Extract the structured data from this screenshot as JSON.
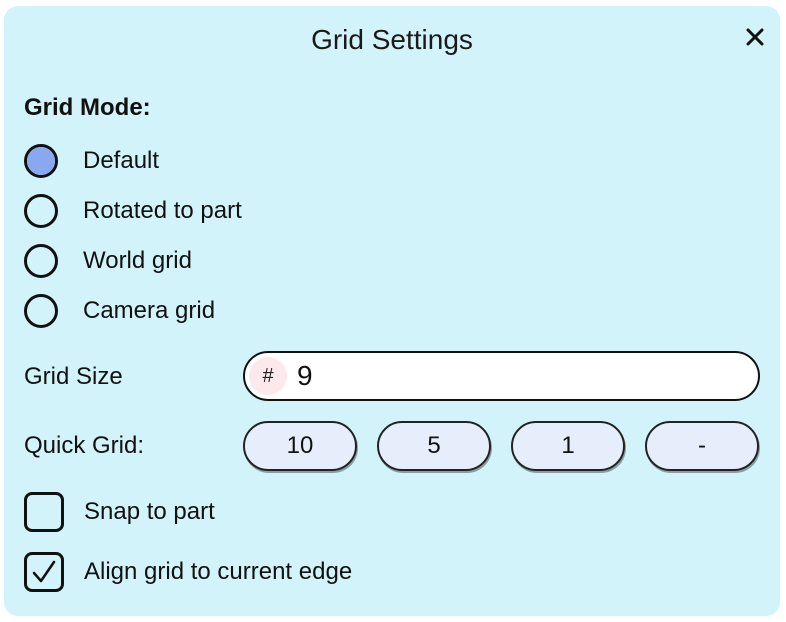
{
  "dialog": {
    "title": "Grid Settings",
    "close_icon": "close-icon"
  },
  "grid_mode": {
    "label": "Grid Mode:",
    "options": [
      {
        "label": "Default",
        "selected": true
      },
      {
        "label": "Rotated to part",
        "selected": false
      },
      {
        "label": "World grid",
        "selected": false
      },
      {
        "label": "Camera grid",
        "selected": false
      }
    ]
  },
  "grid_size": {
    "label": "Grid Size",
    "prefix": "#",
    "value": "9"
  },
  "quick_grid": {
    "label": "Quick Grid:",
    "buttons": [
      "10",
      "5",
      "1",
      "-"
    ]
  },
  "options": {
    "snap_to_part": {
      "label": "Snap to part",
      "checked": false
    },
    "align_grid": {
      "label": "Align grid to current edge",
      "checked": true
    }
  },
  "colors": {
    "background": "#d3f3fb",
    "radio_selected": "#8aa8f0",
    "button_fill": "#e6eefc"
  }
}
